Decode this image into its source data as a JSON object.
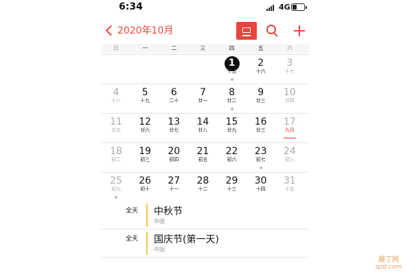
{
  "status_bar": {
    "time": "6:34",
    "network": "4G",
    "signal_icon": "signal-bars-icon",
    "battery_icon": "battery-icon",
    "battery_level": 0.35
  },
  "nav": {
    "back_label": "2020年10月",
    "back_icon": "chevron-left-icon",
    "view_icon": "list-view-icon",
    "search_icon": "search-icon",
    "add_icon": "plus-icon",
    "accent_color": "#e8453c"
  },
  "weekdays": [
    "日",
    "一",
    "二",
    "三",
    "四",
    "五",
    "六"
  ],
  "calendar": {
    "weeks": [
      [
        {
          "day": "",
          "lunar": "",
          "empty": true
        },
        {
          "day": "",
          "lunar": "",
          "empty": true
        },
        {
          "day": "",
          "lunar": "",
          "empty": true
        },
        {
          "day": "",
          "lunar": "",
          "empty": true
        },
        {
          "day": "1",
          "lunar": "十五",
          "today": true,
          "dot": true
        },
        {
          "day": "2",
          "lunar": "十六"
        },
        {
          "day": "3",
          "lunar": "十七",
          "weekend": true
        }
      ],
      [
        {
          "day": "4",
          "lunar": "十八",
          "weekend": true
        },
        {
          "day": "5",
          "lunar": "十九"
        },
        {
          "day": "6",
          "lunar": "二十"
        },
        {
          "day": "7",
          "lunar": "廿一"
        },
        {
          "day": "8",
          "lunar": "廿二",
          "dot": true
        },
        {
          "day": "9",
          "lunar": "廿三"
        },
        {
          "day": "10",
          "lunar": "廿四",
          "weekend": true
        }
      ],
      [
        {
          "day": "11",
          "lunar": "廿五",
          "weekend": true
        },
        {
          "day": "12",
          "lunar": "廿六"
        },
        {
          "day": "13",
          "lunar": "廿七"
        },
        {
          "day": "14",
          "lunar": "廿八"
        },
        {
          "day": "15",
          "lunar": "廿九"
        },
        {
          "day": "16",
          "lunar": "廿三"
        },
        {
          "day": "17",
          "lunar": "九月",
          "weekend": true,
          "holiday": true
        }
      ],
      [
        {
          "day": "18",
          "lunar": "初二",
          "weekend": true
        },
        {
          "day": "19",
          "lunar": "初三"
        },
        {
          "day": "20",
          "lunar": "初四"
        },
        {
          "day": "21",
          "lunar": "初五"
        },
        {
          "day": "22",
          "lunar": "初六"
        },
        {
          "day": "23",
          "lunar": "初七",
          "dot": true
        },
        {
          "day": "24",
          "lunar": "初八",
          "weekend": true
        }
      ],
      [
        {
          "day": "25",
          "lunar": "初九",
          "weekend": true,
          "dot": true
        },
        {
          "day": "26",
          "lunar": "初十"
        },
        {
          "day": "27",
          "lunar": "十一"
        },
        {
          "day": "28",
          "lunar": "十二"
        },
        {
          "day": "29",
          "lunar": "十三"
        },
        {
          "day": "30",
          "lunar": "十四"
        },
        {
          "day": "31",
          "lunar": "十五",
          "weekend": true
        }
      ]
    ]
  },
  "events": [
    {
      "time": "全天",
      "title": "中秋节",
      "location": "中国"
    },
    {
      "time": "全天",
      "title": "国庆节(第一天)",
      "location": "中国"
    }
  ],
  "watermark": {
    "text_cn": "趣丁网",
    "text_en": "qzd.com"
  }
}
